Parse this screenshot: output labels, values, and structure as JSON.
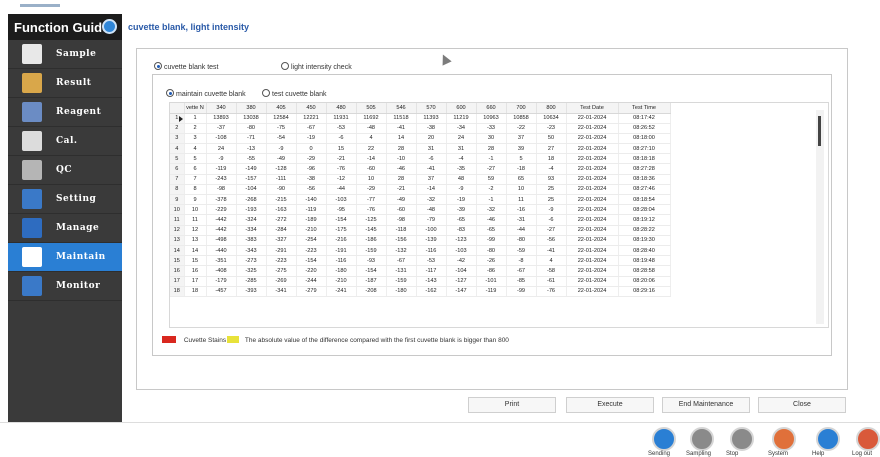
{
  "sidebar": {
    "title": "Function Guide",
    "items": [
      {
        "label": "Sample",
        "icon": "sample-icon",
        "color": "#e8e8e8"
      },
      {
        "label": "Result",
        "icon": "result-icon",
        "color": "#d9a74a"
      },
      {
        "label": "Reagent",
        "icon": "reagent-icon",
        "color": "#6b8cc4"
      },
      {
        "label": "Cal.",
        "icon": "calibration-icon",
        "color": "#dcdcdc"
      },
      {
        "label": "QC",
        "icon": "qc-icon",
        "color": "#b5b5b5"
      },
      {
        "label": "Setting",
        "icon": "setting-icon",
        "color": "#3a79c8"
      },
      {
        "label": "Manage",
        "icon": "manage-icon",
        "color": "#2e6cc0"
      },
      {
        "label": "Maintain",
        "icon": "maintain-icon",
        "color": "#ffffff"
      },
      {
        "label": "Monitor",
        "icon": "monitor-icon",
        "color": "#3a79c8"
      }
    ],
    "active": "Maintain"
  },
  "main": {
    "title": "cuvette blank, light intensity",
    "tabs": [
      "cuvette blank test",
      "light intensity check"
    ],
    "subtabs": [
      "maintain cuvette blank",
      "test cuvette blank"
    ]
  },
  "table": {
    "columns": [
      "",
      "vette N",
      "340",
      "380",
      "405",
      "450",
      "480",
      "505",
      "546",
      "570",
      "600",
      "660",
      "700",
      "800",
      "Test Date",
      "Test Time"
    ],
    "rows": [
      [
        "1",
        "1",
        "13893",
        "13038",
        "12584",
        "12221",
        "11931",
        "11692",
        "11518",
        "11393",
        "11219",
        "10963",
        "10858",
        "10634",
        "22-01-2024",
        "08:17:42"
      ],
      [
        "2",
        "2",
        "-37",
        "-80",
        "-75",
        "-67",
        "-53",
        "-48",
        "-41",
        "-38",
        "-34",
        "-33",
        "-22",
        "-23",
        "22-01-2024",
        "08:26:52"
      ],
      [
        "3",
        "3",
        "-108",
        "-71",
        "-54",
        "-19",
        "-6",
        "4",
        "14",
        "20",
        "24",
        "30",
        "37",
        "50",
        "22-01-2024",
        "08:18:00"
      ],
      [
        "4",
        "4",
        "24",
        "-13",
        "-9",
        "0",
        "15",
        "22",
        "28",
        "31",
        "31",
        "28",
        "39",
        "27",
        "22-01-2024",
        "08:27:10"
      ],
      [
        "5",
        "5",
        "-9",
        "-55",
        "-49",
        "-29",
        "-21",
        "-14",
        "-10",
        "-6",
        "-4",
        "-1",
        "5",
        "18",
        "22-01-2024",
        "08:18:18"
      ],
      [
        "6",
        "6",
        "-119",
        "-149",
        "-128",
        "-96",
        "-76",
        "-60",
        "-46",
        "-41",
        "-35",
        "-27",
        "-18",
        "-4",
        "22-01-2024",
        "08:27:28"
      ],
      [
        "7",
        "7",
        "-243",
        "-157",
        "-111",
        "-38",
        "-12",
        "10",
        "28",
        "37",
        "48",
        "59",
        "65",
        "93",
        "22-01-2024",
        "08:18:36"
      ],
      [
        "8",
        "8",
        "-98",
        "-104",
        "-90",
        "-56",
        "-44",
        "-29",
        "-21",
        "-14",
        "-9",
        "-2",
        "10",
        "25",
        "22-01-2024",
        "08:27:46"
      ],
      [
        "9",
        "9",
        "-378",
        "-268",
        "-215",
        "-140",
        "-103",
        "-77",
        "-49",
        "-32",
        "-19",
        "-1",
        "11",
        "25",
        "22-01-2024",
        "08:18:54"
      ],
      [
        "10",
        "10",
        "-229",
        "-193",
        "-163",
        "-119",
        "-95",
        "-76",
        "-60",
        "-48",
        "-39",
        "-32",
        "-16",
        "-9",
        "22-01-2024",
        "08:28:04"
      ],
      [
        "11",
        "11",
        "-442",
        "-324",
        "-272",
        "-189",
        "-154",
        "-125",
        "-98",
        "-79",
        "-65",
        "-46",
        "-31",
        "-6",
        "22-01-2024",
        "08:19:12"
      ],
      [
        "12",
        "12",
        "-442",
        "-334",
        "-284",
        "-210",
        "-175",
        "-145",
        "-118",
        "-100",
        "-83",
        "-65",
        "-44",
        "-27",
        "22-01-2024",
        "08:28:22"
      ],
      [
        "13",
        "13",
        "-498",
        "-383",
        "-327",
        "-254",
        "-216",
        "-186",
        "-156",
        "-139",
        "-123",
        "-99",
        "-80",
        "-56",
        "22-01-2024",
        "08:19:30"
      ],
      [
        "14",
        "14",
        "-440",
        "-343",
        "-291",
        "-223",
        "-191",
        "-159",
        "-132",
        "-116",
        "-103",
        "-80",
        "-59",
        "-41",
        "22-01-2024",
        "08:28:40"
      ],
      [
        "15",
        "15",
        "-351",
        "-273",
        "-223",
        "-154",
        "-116",
        "-93",
        "-67",
        "-53",
        "-42",
        "-26",
        "-8",
        "4",
        "22-01-2024",
        "08:19:48"
      ],
      [
        "16",
        "16",
        "-408",
        "-325",
        "-275",
        "-220",
        "-180",
        "-154",
        "-131",
        "-117",
        "-104",
        "-86",
        "-67",
        "-58",
        "22-01-2024",
        "08:28:58"
      ],
      [
        "17",
        "17",
        "-179",
        "-285",
        "-269",
        "-244",
        "-210",
        "-187",
        "-159",
        "-143",
        "-127",
        "-101",
        "-85",
        "-61",
        "22-01-2024",
        "08:20:06"
      ],
      [
        "18",
        "18",
        "-457",
        "-393",
        "-341",
        "-279",
        "-241",
        "-208",
        "-180",
        "-162",
        "-147",
        "-119",
        "-99",
        "-76",
        "22-01-2024",
        "08:29:16"
      ]
    ]
  },
  "legend": {
    "stain_label": "Cuvette Stains",
    "note": "The absolute value of the difference compared with the first cuvette blank is bigger than 800",
    "colors": {
      "stain": "#d9281f",
      "over": "#e8e23a"
    }
  },
  "buttons": {
    "print": "Print",
    "execute": "Execute",
    "end": "End Maintenance",
    "close": "Close"
  },
  "bottom": [
    {
      "label": "Sending",
      "icon": "play-icon",
      "color": "#2a7fd4"
    },
    {
      "label": "Sampling",
      "icon": "pause-icon",
      "color": "#8a8a8a"
    },
    {
      "label": "Stop",
      "icon": "stop-icon",
      "color": "#8a8a8a"
    },
    {
      "label": "System",
      "icon": "system-icon",
      "color": "#e0703a"
    },
    {
      "label": "Help",
      "icon": "help-icon",
      "color": "#2a7fd4"
    },
    {
      "label": "Log out",
      "icon": "logout-icon",
      "color": "#d9593a"
    }
  ]
}
